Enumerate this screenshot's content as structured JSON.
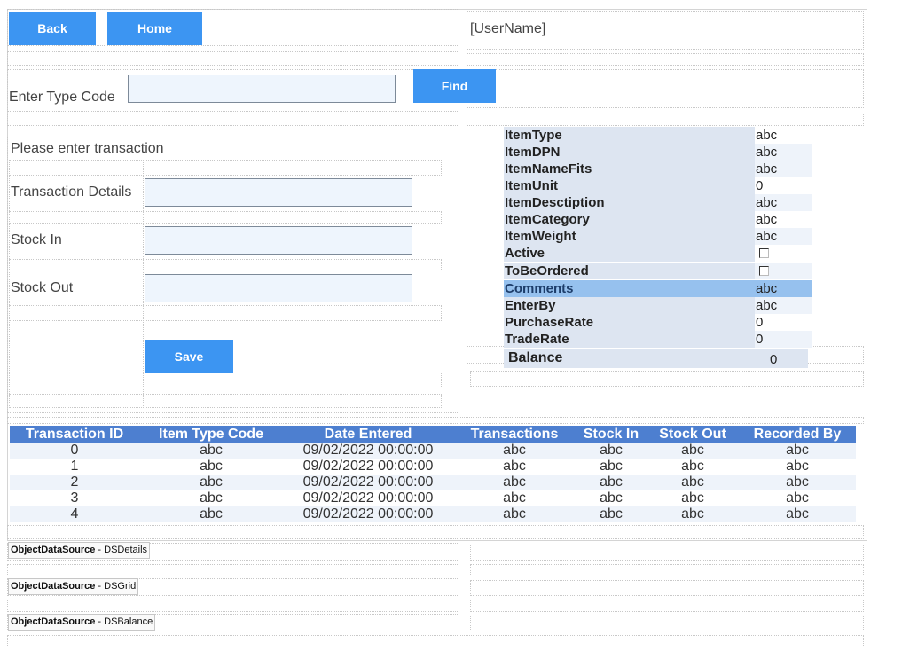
{
  "header": {
    "back_label": "Back",
    "home_label": "Home",
    "username": "[UserName]"
  },
  "search": {
    "label": "Enter Type Code",
    "value": "",
    "find_label": "Find"
  },
  "form": {
    "prompt": "Please enter transaction",
    "transaction_details_label": "Transaction Details",
    "transaction_details_value": "",
    "stock_in_label": "Stock In",
    "stock_in_value": "",
    "stock_out_label": "Stock Out",
    "stock_out_value": "",
    "save_label": "Save"
  },
  "details": {
    "rows": [
      {
        "key": "ItemType",
        "value": "abc"
      },
      {
        "key": "ItemDPN",
        "value": "abc"
      },
      {
        "key": "ItemNameFits",
        "value": "abc"
      },
      {
        "key": "ItemUnit",
        "value": "0"
      },
      {
        "key": "ItemDesctiption",
        "value": "abc"
      },
      {
        "key": "ItemCategory",
        "value": "abc"
      },
      {
        "key": "ItemWeight",
        "value": "abc"
      },
      {
        "key": "Active",
        "value": ""
      },
      {
        "key": "ToBeOrdered",
        "value": ""
      },
      {
        "key": "Comments",
        "value": "abc"
      },
      {
        "key": "EnterBy",
        "value": "abc"
      },
      {
        "key": "PurchaseRate",
        "value": "0"
      },
      {
        "key": "TradeRate",
        "value": "0"
      }
    ],
    "active_checked": false,
    "tobeordered_checked": false
  },
  "balance": {
    "label": "Balance",
    "value": "0"
  },
  "grid": {
    "headers": [
      "Transaction ID",
      "Item Type Code",
      "Date Entered",
      "Transactions",
      "Stock In",
      "Stock Out",
      "Recorded By"
    ],
    "rows": [
      [
        "0",
        "abc",
        "09/02/2022 00:00:00",
        "abc",
        "abc",
        "abc",
        "abc"
      ],
      [
        "1",
        "abc",
        "09/02/2022 00:00:00",
        "abc",
        "abc",
        "abc",
        "abc"
      ],
      [
        "2",
        "abc",
        "09/02/2022 00:00:00",
        "abc",
        "abc",
        "abc",
        "abc"
      ],
      [
        "3",
        "abc",
        "09/02/2022 00:00:00",
        "abc",
        "abc",
        "abc",
        "abc"
      ],
      [
        "4",
        "abc",
        "09/02/2022 00:00:00",
        "abc",
        "abc",
        "abc",
        "abc"
      ]
    ]
  },
  "datasources": [
    {
      "type": "ObjectDataSource",
      "name": " - DSDetails"
    },
    {
      "type": "ObjectDataSource",
      "name": " - DSGrid"
    },
    {
      "type": "ObjectDataSource",
      "name": " - DSBalance"
    }
  ],
  "colors": {
    "button": "#3c95f2",
    "grid_header": "#4d7fd0",
    "detail_key_bg": "#dde5f1",
    "highlight": "#96c1ee"
  }
}
